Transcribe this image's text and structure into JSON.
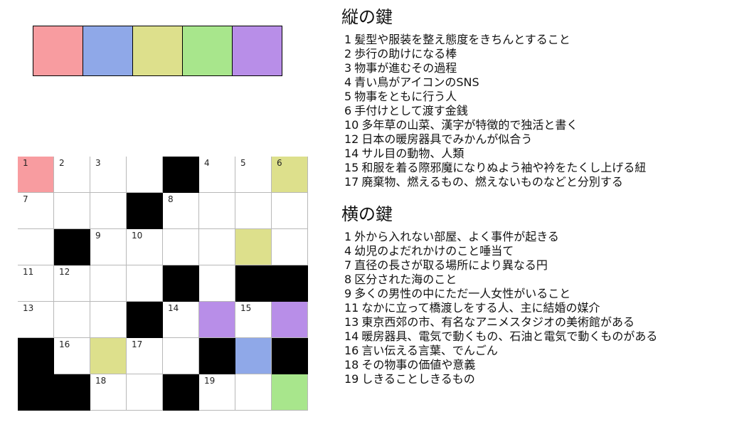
{
  "colors": {
    "pink": "#f89ca0",
    "blue": "#8fa8e8",
    "yellow": "#dde08c",
    "green": "#a8e68c",
    "purple": "#b88ee8",
    "block": "#000000"
  },
  "answer_strip": [
    "pink",
    "blue",
    "yellow",
    "green",
    "purple"
  ],
  "grid": {
    "rows": 7,
    "cols": 8,
    "cells": [
      [
        {
          "n": "1",
          "c": "pink"
        },
        {
          "n": "2"
        },
        {
          "n": "3"
        },
        {},
        {
          "b": true
        },
        {
          "n": "4"
        },
        {
          "n": "5"
        },
        {
          "n": "6",
          "c": "yellow"
        }
      ],
      [
        {
          "n": "7"
        },
        {},
        {},
        {
          "b": true
        },
        {
          "n": "8"
        },
        {},
        {},
        {}
      ],
      [
        {},
        {
          "b": true
        },
        {
          "n": "9"
        },
        {
          "n": "10"
        },
        {},
        {},
        {
          "c": "yellow"
        },
        {}
      ],
      [
        {
          "n": "11"
        },
        {
          "n": "12"
        },
        {},
        {},
        {
          "b": true
        },
        {},
        {
          "b": true
        },
        {
          "b": true
        }
      ],
      [
        {
          "n": "13"
        },
        {},
        {},
        {
          "b": true
        },
        {
          "n": "14"
        },
        {
          "c": "purple"
        },
        {
          "n": "15"
        },
        {
          "c": "purple"
        }
      ],
      [
        {
          "b": true
        },
        {
          "n": "16"
        },
        {
          "c": "yellow"
        },
        {
          "n": "17"
        },
        {},
        {
          "b": true
        },
        {
          "c": "blue"
        },
        {
          "b": true
        }
      ],
      [
        {
          "b": true
        },
        {
          "b": true
        },
        {
          "n": "18"
        },
        {},
        {
          "b": true
        },
        {
          "n": "19"
        },
        {},
        {
          "c": "green"
        }
      ]
    ]
  },
  "down": {
    "title": "縦の鍵",
    "clues": [
      {
        "no": "1",
        "text": "髪型や服装を整え態度をきちんとすること"
      },
      {
        "no": "2",
        "text": "歩行の助けになる棒"
      },
      {
        "no": "3",
        "text": "物事が進むその過程"
      },
      {
        "no": "4",
        "text": "青い鳥がアイコンのSNS"
      },
      {
        "no": "5",
        "text": "物事をともに行う人"
      },
      {
        "no": "6",
        "text": "手付けとして渡す金銭"
      },
      {
        "no": "10",
        "text": "多年草の山菜、漢字が特徴的で独活と書く"
      },
      {
        "no": "12",
        "text": "日本の暖房器具でみかんが似合う"
      },
      {
        "no": "14",
        "text": "サル目の動物、人類"
      },
      {
        "no": "15",
        "text": "和服を着る際邪魔になりぬよう袖や衿をたくし上げる紐"
      },
      {
        "no": "17",
        "text": "廃棄物、燃えるもの、燃えないものなどと分別する"
      }
    ]
  },
  "across": {
    "title": "横の鍵",
    "clues": [
      {
        "no": "1",
        "text": "外から入れない部屋、よく事件が起きる"
      },
      {
        "no": "4",
        "text": "幼児のよだれかけのこと唾当て"
      },
      {
        "no": "7",
        "text": "直径の長さが取る場所により異なる円"
      },
      {
        "no": "8",
        "text": "区分された海のこと"
      },
      {
        "no": "9",
        "text": "多くの男性の中にただ一人女性がいること"
      },
      {
        "no": "11",
        "text": "なかに立って橋渡しをする人、主に結婚の媒介"
      },
      {
        "no": "13",
        "text": "東京西郊の市、有名なアニメスタジオの美術館がある"
      },
      {
        "no": "14",
        "text": "暖房器具、電気で動くもの、石油と電気で動くものがある"
      },
      {
        "no": "16",
        "text": "言い伝える言葉、でんごん"
      },
      {
        "no": "18",
        "text": "その物事の価値や意義"
      },
      {
        "no": "19",
        "text": "しきることしきるもの"
      }
    ]
  }
}
